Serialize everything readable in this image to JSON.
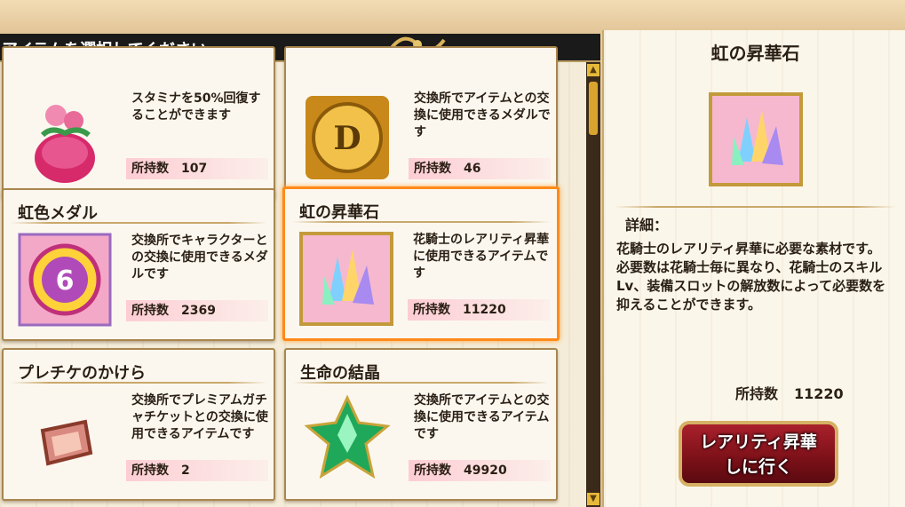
{
  "header": {
    "title": "アイテムを選択してください"
  },
  "items": [
    {
      "name": "",
      "desc": "スタミナを50%回復することができます",
      "count_label": "所持数",
      "count": "107",
      "icon": "stamina-potion-icon"
    },
    {
      "name": "",
      "desc": "交換所でアイテムとの交換に使用できるメダルです",
      "count_label": "所持数",
      "count": "46",
      "icon": "d-medal-icon"
    },
    {
      "name": "虹色メダル",
      "desc": "交換所でキャラクターとの交換に使用できるメダルです",
      "count_label": "所持数",
      "count": "2369",
      "icon": "rainbow-medal-icon"
    },
    {
      "name": "虹の昇華石",
      "desc": "花騎士のレアリティ昇華に使用できるアイテムです",
      "count_label": "所持数",
      "count": "11220",
      "icon": "rainbow-crystal-icon"
    },
    {
      "name": "プレチケのかけら",
      "desc": "交換所でプレミアムガチャチケットとの交換に使用できるアイテムです",
      "count_label": "所持数",
      "count": "2",
      "icon": "ticket-fragment-icon"
    },
    {
      "name": "生命の結晶",
      "desc": "交換所でアイテムとの交換に使用できるアイテムです",
      "count_label": "所持数",
      "count": "49920",
      "icon": "life-crystal-icon"
    }
  ],
  "detail": {
    "title": "虹の昇華石",
    "label": "詳細：",
    "desc": "花騎士のレアリティ昇華に必要な素材です。\n必要数は花騎士毎に異なり、花騎士のスキルLv、装備スロットの解放数によって必要数を抑えることができます。",
    "count_label": "所持数",
    "count": "11220",
    "button_line1": "レアリティ昇華",
    "button_line2": "しに行く"
  },
  "colors": {
    "selected_border": "#ff8a1a",
    "button": "#8b1520"
  }
}
